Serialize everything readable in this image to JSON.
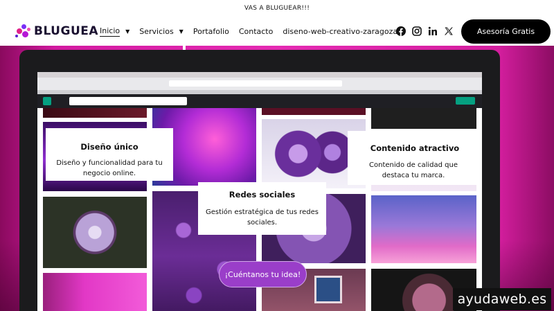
{
  "topbar": {
    "text": "VAS A BLUGUEAR!!!"
  },
  "logo": {
    "text": "BLUGUEA"
  },
  "nav": {
    "items": [
      {
        "label": "Inicio",
        "has_dropdown": true,
        "active": true
      },
      {
        "label": "Servicios",
        "has_dropdown": true,
        "active": false
      },
      {
        "label": "Portafolio",
        "has_dropdown": false,
        "active": false
      },
      {
        "label": "Contacto",
        "has_dropdown": false,
        "active": false
      },
      {
        "label": "diseno-web-creativo-zaragoza",
        "has_dropdown": false,
        "active": false
      }
    ],
    "dropdown_glyph": "▼"
  },
  "social": {
    "icons": [
      "facebook-icon",
      "instagram-icon",
      "linkedin-icon",
      "x-icon"
    ]
  },
  "cta": {
    "label": "Asesoría Gratis"
  },
  "cards": [
    {
      "title": "Diseño único",
      "text": "Diseño y funcionalidad para tu negocio online."
    },
    {
      "title": "Redes sociales",
      "text": "Gestión estratégica de tus redes sociales."
    },
    {
      "title": "Contenido atractivo",
      "text": "Contenido de calidad que destaca tu marca."
    }
  ],
  "hero_button": {
    "label": "¡Cuéntanos tu idea!"
  },
  "watermark": {
    "text": "ayudaweb.es"
  },
  "colors": {
    "brand_purple": "#9a3ec9",
    "hero_pink": "#e52bb3",
    "cta_black": "#000000",
    "pexels_green": "#05a081"
  }
}
